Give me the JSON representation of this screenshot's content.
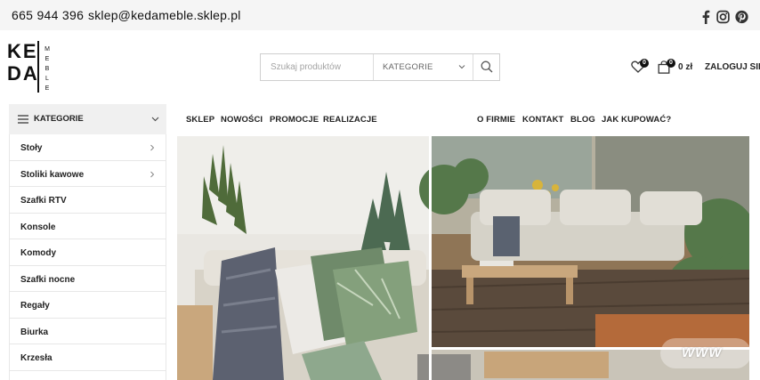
{
  "topbar": {
    "phone": "665 944 396",
    "email": "sklep@kedameble.sklep.pl",
    "social": [
      "facebook-icon",
      "instagram-icon",
      "pinterest-icon"
    ]
  },
  "logo": {
    "line1": "KE",
    "line2": "DA",
    "line3": "",
    "side_text": "MEBLE"
  },
  "search": {
    "placeholder": "Szukaj produktów",
    "category_select": "KATEGORIE",
    "search_icon": "search-icon"
  },
  "header_actions": {
    "wishlist_count": "0",
    "cart_count": "0",
    "cart_total": "0 zł",
    "login_label": "ZALOGUJ SIĘ"
  },
  "sidebar": {
    "title": "KATEGORIE",
    "items": [
      {
        "label": "Stoły",
        "has_children": true
      },
      {
        "label": "Stoliki kawowe",
        "has_children": true
      },
      {
        "label": "Szafki RTV",
        "has_children": false
      },
      {
        "label": "Konsole",
        "has_children": false
      },
      {
        "label": "Komody",
        "has_children": false
      },
      {
        "label": "Szafki nocne",
        "has_children": false
      },
      {
        "label": "Regały",
        "has_children": false
      },
      {
        "label": "Biurka",
        "has_children": false
      },
      {
        "label": "Krzesła",
        "has_children": false
      }
    ]
  },
  "nav": {
    "left": [
      "SKLEP",
      "NOWOŚCI",
      "PROMOCJE",
      "REALIZACJE"
    ],
    "right": [
      "O FIRMIE",
      "KONTAKT",
      "BLOG",
      "JAK KUPOWAĆ?"
    ]
  },
  "hero": {
    "watermark": "WWW"
  },
  "colors": {
    "topbar_bg": "#f5f5f5",
    "catbar_bg": "#f0f0f0",
    "text": "#222222",
    "badge": "#111111"
  }
}
